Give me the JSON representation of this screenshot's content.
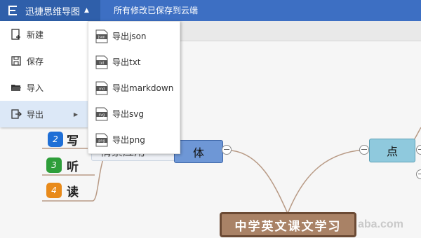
{
  "app": {
    "title": "迅捷思维导图",
    "save_status": "所有修改已保存到云端",
    "menu_caret": "▲",
    "logo_icon": "mindmap-logo-icon"
  },
  "file_menu": {
    "items": [
      {
        "label": "新建",
        "icon": "new-file-icon"
      },
      {
        "label": "保存",
        "icon": "save-icon"
      },
      {
        "label": "导入",
        "icon": "folder-open-icon"
      },
      {
        "label": "导出",
        "icon": "export-icon",
        "arrow": "▶",
        "active": true
      }
    ]
  },
  "export_submenu": {
    "items": [
      {
        "label": "导出json",
        "icon_text": "json"
      },
      {
        "label": "导出txt",
        "icon_text": "txt"
      },
      {
        "label": "导出markdown",
        "icon_text": "md"
      },
      {
        "label": "导出svg",
        "icon_text": "svg"
      },
      {
        "label": "导出png",
        "icon_text": "png"
      }
    ]
  },
  "mindmap": {
    "root": "中学英文课文学习",
    "left_main": "体",
    "left_partial": "情景应用",
    "right_main": "点",
    "left_items": [
      {
        "number": "2",
        "label": "写",
        "color": "#1f6fd6"
      },
      {
        "number": "3",
        "label": "听",
        "color": "#2e9e3a"
      },
      {
        "number": "4",
        "label": "读",
        "color": "#e88a1a"
      }
    ]
  },
  "watermark": "aba.com",
  "colors": {
    "topbar": "#3d6fc3",
    "app_button": "#2f5faa",
    "root_fill": "#a98266",
    "root_border": "#6b4a34",
    "left_main_fill": "#6e97d6",
    "right_main_fill": "#8fc9dd"
  }
}
